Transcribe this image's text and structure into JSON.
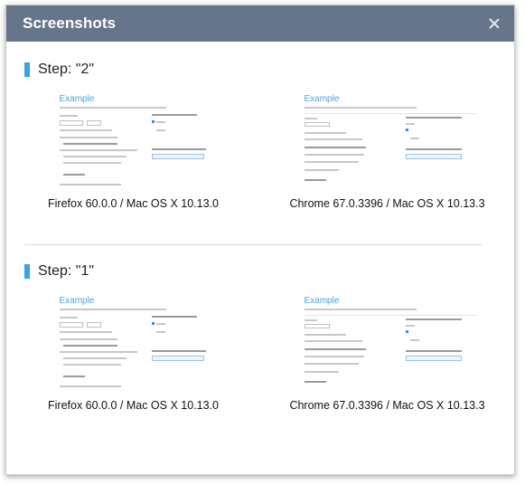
{
  "dialog": {
    "title": "Screenshots",
    "close_icon": "close-icon"
  },
  "steps": [
    {
      "label": "Step: \"2\"",
      "shots": [
        {
          "caption": "Firefox 60.0.0 / Mac OS X 10.13.0",
          "page_title": "Example"
        },
        {
          "caption": "Chrome 67.0.3396 / Mac OS X 10.13.3",
          "page_title": "Example"
        }
      ]
    },
    {
      "label": "Step: \"1\"",
      "shots": [
        {
          "caption": "Firefox 60.0.0 / Mac OS X 10.13.0",
          "page_title": "Example"
        },
        {
          "caption": "Chrome 67.0.3396 / Mac OS X 10.13.3",
          "page_title": "Example"
        }
      ]
    }
  ],
  "colors": {
    "header_bg": "#67758b",
    "accent": "#3aa3e3",
    "mini_title": "#4aa3d8"
  }
}
